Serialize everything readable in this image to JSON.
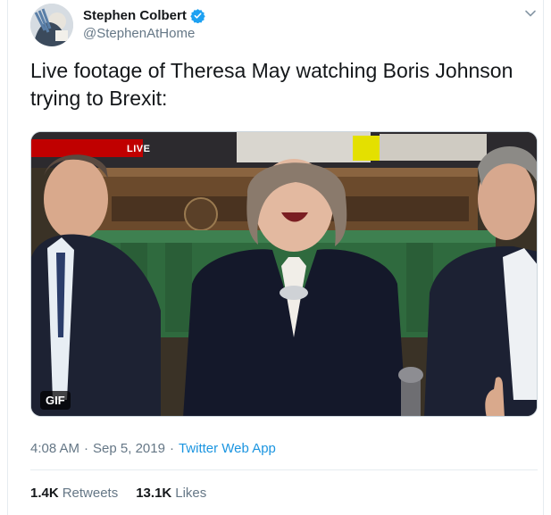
{
  "tweet": {
    "author": {
      "display_name": "Stephen Colbert",
      "handle": "@StephenAtHome",
      "verified": true
    },
    "text": "Live footage of Theresa May watching Boris Johnson\ntrying to Brexit:",
    "media": {
      "live_label": "LIVE",
      "gif_label": "GIF"
    },
    "meta": {
      "time": "4:08 AM",
      "separator": "·",
      "date": "Sep 5, 2019",
      "source": "Twitter Web App"
    },
    "stats": {
      "retweets_count": "1.4K",
      "retweets_label": "Retweets",
      "likes_count": "13.1K",
      "likes_label": "Likes"
    }
  },
  "colors": {
    "link": "#1b95e0",
    "verified": "#1da1f2",
    "secondary_text": "#657786",
    "live_banner": "#c00000"
  }
}
